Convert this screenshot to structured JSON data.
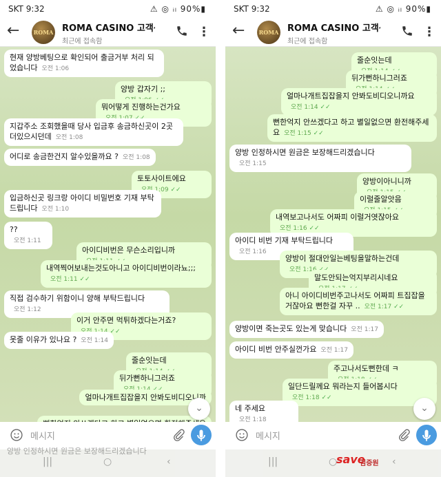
{
  "status": {
    "carrier": "SKT 9:32",
    "indicators": "⚠ ◎ ᵢₗ 90%▮"
  },
  "header": {
    "title": "ROMA CASINO 고객센",
    "subtitle": "최근에 접속함",
    "avatar_text": "ROMA"
  },
  "left_messages": [
    {
      "dir": "in",
      "text": "현재 양방베팅으로 확인되어 출금거부 처리 되었습니다",
      "time": "오전 1:06"
    },
    {
      "dir": "out",
      "text": "양방 갑자기 ;;",
      "time": "오전 1:06"
    },
    {
      "dir": "out",
      "text": "뭐어떻게 진행하는건가요",
      "time": "오전 1:07"
    },
    {
      "dir": "in",
      "text": "지갑주소 조회했을때 당사 입금후 송금하신곳이 2곳 더있으시던데",
      "time": "오전 1:08"
    },
    {
      "dir": "in",
      "text": "어디로 송금한건지 알수있을까요 ?",
      "time": "오전 1:08"
    },
    {
      "dir": "out",
      "text": "토토사이트에요",
      "time": "오전 1:09"
    },
    {
      "dir": "in",
      "text": "입금하신곳 링크랑 아이디 비밀번호 기재 부탁드립니다",
      "time": "오전 1:10"
    },
    {
      "dir": "in",
      "text": "??",
      "time": "오전 1:11"
    },
    {
      "dir": "out",
      "text": "아이디비번은 무슨소리입니까",
      "time": "오전 1:11"
    },
    {
      "dir": "out",
      "text": "내역찍어보내는것도아니고 아이디비번이라뇨;;;",
      "time": "오전 1:11"
    },
    {
      "dir": "in",
      "text": "직접 검수하기 위함이니 양해 부탁드립니다",
      "time": "오전 1:12"
    },
    {
      "dir": "out",
      "text": "이거 안주면 먹튀하겠다는거죠?",
      "time": "오전 1:14"
    },
    {
      "dir": "in",
      "text": "못줄 이유가 있나요 ?",
      "time": "오전 1:14"
    },
    {
      "dir": "out",
      "text": "줄순잇는데",
      "time": "오전 1:14"
    },
    {
      "dir": "out",
      "text": "뒤가뻔하니그러죠",
      "time": "오전 1:14"
    },
    {
      "dir": "out",
      "text": "얼마나개트집잡을지 안봐도비디오니까",
      "time": ""
    },
    {
      "dir": "out",
      "text": "뻔한억지 안쓰겠다고 하고 별일없으면 환전해주세요",
      "time": ""
    }
  ],
  "right_messages": [
    {
      "dir": "out",
      "text": "줄순잇는데",
      "time": "오전 1:14"
    },
    {
      "dir": "out",
      "text": "뒤가뻔하니그러죠",
      "time": "오전 1:14"
    },
    {
      "dir": "out",
      "text": "얼마나개트집잡을지 안봐도비디오니까요",
      "time": "오전 1:14"
    },
    {
      "dir": "out",
      "text": "뻔한억지 안쓰겠다고 하고 별일없으면 환전해주세요",
      "time": "오전 1:15"
    },
    {
      "dir": "in",
      "text": "양방 인정하시면 원금은 보장해드리겠습니다",
      "time": "오전 1:15"
    },
    {
      "dir": "out",
      "text": "양방이아니니까",
      "time": "오전 1:15"
    },
    {
      "dir": "out",
      "text": "이럴줄알앗음",
      "time": "오전 1:15"
    },
    {
      "dir": "out",
      "text": "내역보고나서도 어짜피 이럴거엿잖아요",
      "time": "오전 1:16"
    },
    {
      "dir": "in",
      "text": "아이디 비번 기재 부탁드립니다",
      "time": "오전 1:16"
    },
    {
      "dir": "out",
      "text": "양방이 절대안일는베팅을말하는건데",
      "time": "오전 1:16"
    },
    {
      "dir": "out",
      "text": "말도안되는억지부리시네요",
      "time": "오전 1:17"
    },
    {
      "dir": "out",
      "text": "아니 아이디비번주고나서도 어짜피 트집잡을거잖아요 뻔한걸 자꾸 ..",
      "time": "오전 1:17"
    },
    {
      "dir": "in",
      "text": "양방이면 죽는곳도 있는게 맞습니다",
      "time": "오전 1:17"
    },
    {
      "dir": "in",
      "text": "아이디 비번 안주실껀가요",
      "time": "오전 1:17"
    },
    {
      "dir": "out",
      "text": "주고나서도뻔한데 ㅋ",
      "time": "오전 1:18"
    },
    {
      "dir": "out",
      "text": "일단드릴께요 뭐라는지 들어봅시다",
      "time": "오전 1:18"
    },
    {
      "dir": "in",
      "text": "네 주세요",
      "time": "오전 1:18"
    }
  ],
  "input": {
    "placeholder": "메시지"
  },
  "left_ghost": "양방 인정하시면 원금은 보장해드리겠습니다",
  "watermark": {
    "brand": "save",
    "org": "검증원",
    "tagline": "검증커뮤니티바로가기"
  },
  "colors": {
    "incoming": "#ffffff",
    "outgoing": "#eaffd7",
    "accent": "#4a9be0"
  }
}
